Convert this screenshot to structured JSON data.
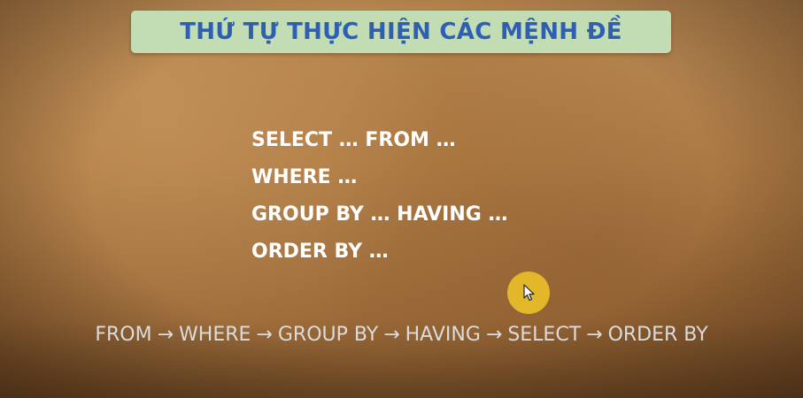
{
  "title": "THỨ TỰ THỰC HIỆN CÁC MỆNH ĐỀ",
  "clauses": [
    "SELECT … FROM …",
    "WHERE …",
    "GROUP BY … HAVING …",
    "ORDER BY …"
  ],
  "execution_order": {
    "steps": [
      "FROM",
      "WHERE",
      "GROUP BY",
      "HAVING",
      "SELECT",
      "ORDER BY"
    ],
    "arrow": "→"
  },
  "colors": {
    "title_box": "#c2dcb3",
    "title_text": "#2f5fb3",
    "clause_text": "#ffffff",
    "order_text": "#dbdbdb",
    "cursor_highlight": "#e8be28"
  },
  "icons": {
    "cursor": "mouse-pointer-icon"
  }
}
